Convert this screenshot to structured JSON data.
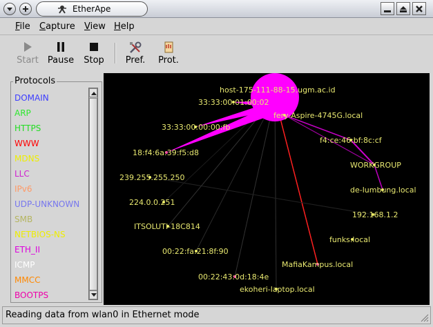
{
  "window": {
    "title": "EtherApe"
  },
  "menu": [
    {
      "label": "File",
      "key": "F",
      "rest": "ile"
    },
    {
      "label": "Capture",
      "key": "C",
      "rest": "apture"
    },
    {
      "label": "View",
      "key": "V",
      "rest": "iew"
    },
    {
      "label": "Help",
      "key": "H",
      "rest": "elp"
    }
  ],
  "toolbar": {
    "start": "Start",
    "pause": "Pause",
    "stop": "Stop",
    "pref": "Pref.",
    "prot": "Prot."
  },
  "protocols": {
    "title": "Protocols",
    "items": [
      {
        "name": "DOMAIN",
        "color": "#3d3dff"
      },
      {
        "name": "ARP",
        "color": "#2ee82e"
      },
      {
        "name": "HTTPS",
        "color": "#22dd22"
      },
      {
        "name": "WWW",
        "color": "#ff0000"
      },
      {
        "name": "MDNS",
        "color": "#eeee00"
      },
      {
        "name": "LLC",
        "color": "#d020d0"
      },
      {
        "name": "IPv6",
        "color": "#ff9966"
      },
      {
        "name": "UDP-UNKNOWN",
        "color": "#7777ee"
      },
      {
        "name": "SMB",
        "color": "#b5b560"
      },
      {
        "name": "NETBIOS-NS",
        "color": "#eeee00"
      },
      {
        "name": "ETH_II",
        "color": "#dd00dd"
      },
      {
        "name": "ICMP",
        "color": "#ffffff"
      },
      {
        "name": "MMCC",
        "color": "#ff8800"
      },
      {
        "name": "BOOTPS",
        "color": "#ee00aa"
      }
    ]
  },
  "graph": {
    "label_color": "#e8e870",
    "hub_color": "#ff00ff",
    "nodes": [
      {
        "id": "hub",
        "label": "host-175-111-88-15.ugm.ac.id"
      },
      {
        "id": "fery",
        "label": "fery-Aspire-4745G.local"
      },
      {
        "id": "n1",
        "label": "33:33:00:01:00:02"
      },
      {
        "id": "n2",
        "label": "33:33:00:00:00:fb"
      },
      {
        "id": "n3",
        "label": "18:f4:6a:39:f5:d8"
      },
      {
        "id": "n4",
        "label": "239.255.255.250"
      },
      {
        "id": "n5",
        "label": "224.0.0.251"
      },
      {
        "id": "n6",
        "label": "ITSOLUTI-18C814"
      },
      {
        "id": "n7",
        "label": "00:22:fa:21:8f:90"
      },
      {
        "id": "n8",
        "label": "00:22:43:0d:18:4e"
      },
      {
        "id": "n9",
        "label": "ekoheri-laptop.local"
      },
      {
        "id": "n10",
        "label": "MafiaKampus.local"
      },
      {
        "id": "n11",
        "label": "funks.local"
      },
      {
        "id": "n12",
        "label": "192.168.1.2"
      },
      {
        "id": "n13",
        "label": "de-lumbung.local"
      },
      {
        "id": "n14",
        "label": "WORKGROUP"
      },
      {
        "id": "n15",
        "label": "f4:ce:46:bf:8c:cf"
      }
    ]
  },
  "status": {
    "text": "Reading data from wlan0 in Ethernet mode"
  }
}
